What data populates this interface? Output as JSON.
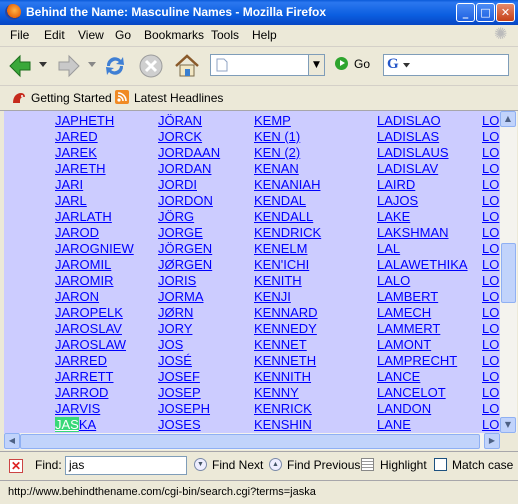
{
  "window": {
    "title": "Behind the Name: Masculine Names - Mozilla Firefox"
  },
  "menu": [
    "File",
    "Edit",
    "View",
    "Go",
    "Bookmarks",
    "Tools",
    "Help"
  ],
  "nav": {
    "go_label": "Go"
  },
  "bookmarks": [
    "Getting Started",
    "Latest Headlines"
  ],
  "columns": [
    [
      "JAPHETH",
      "JARED",
      "JAREK",
      "JARETH",
      "JARI",
      "JARL",
      "JARLATH",
      "JAROD",
      "JAROGNIEW",
      "JAROMIL",
      "JAROMIR",
      "JARON",
      "JAROPELK",
      "JAROSLAV",
      "JAROSLAW",
      "JARRED",
      "JARRETT",
      "JARROD",
      "JARVIS",
      "JASKA"
    ],
    [
      "JÖRAN",
      "JORCK",
      "JORDAAN",
      "JORDAN",
      "JORDI",
      "JORDON",
      "JÖRG",
      "JORGE",
      "JÖRGEN",
      "JØRGEN",
      "JORIS",
      "JORMA",
      "JØRN",
      "JORY",
      "JOS",
      "JOSÉ",
      "JOSEF",
      "JOSEP",
      "JOSEPH",
      "JOSES"
    ],
    [
      "KEMP",
      "KEN (1)",
      "KEN (2)",
      "KENAN",
      "KENANIAH",
      "KENDAL",
      "KENDALL",
      "KENDRICK",
      "KENELM",
      "KEN'ICHI",
      "KENITH",
      "KENJI",
      "KENNARD",
      "KENNEDY",
      "KENNET",
      "KENNETH",
      "KENNITH",
      "KENNY",
      "KENRICK",
      "KENSHIN"
    ],
    [
      "LADISLAO",
      "LADISLAS",
      "LADISLAUS",
      "LADISLAV",
      "LAIRD",
      "LAJOS",
      "LAKE",
      "LAKSHMAN",
      "LAL",
      "LALAWETHIKA",
      "LALO",
      "LAMBERT",
      "LAMECH",
      "LAMMERT",
      "LAMONT",
      "LAMPRECHT",
      "LANCE",
      "LANCELOT",
      "LANDON",
      "LANE"
    ],
    [
      "LO",
      "LO",
      "LO",
      "LO",
      "LO",
      "LO",
      "LO",
      "LO",
      "LO",
      "LO",
      "LO",
      "LO",
      "LO",
      "LO",
      "LO",
      "LO",
      "LO",
      "LO",
      "LO",
      "LO"
    ]
  ],
  "find": {
    "label": "Find:",
    "value": "jas",
    "next_label": "Find Next",
    "prev_label": "Find Previous",
    "highlight_label": "Highlight",
    "matchcase_label": "Match case"
  },
  "status": {
    "text": "http://www.behindthename.com/cgi-bin/search.cgi?terms=jaska"
  }
}
